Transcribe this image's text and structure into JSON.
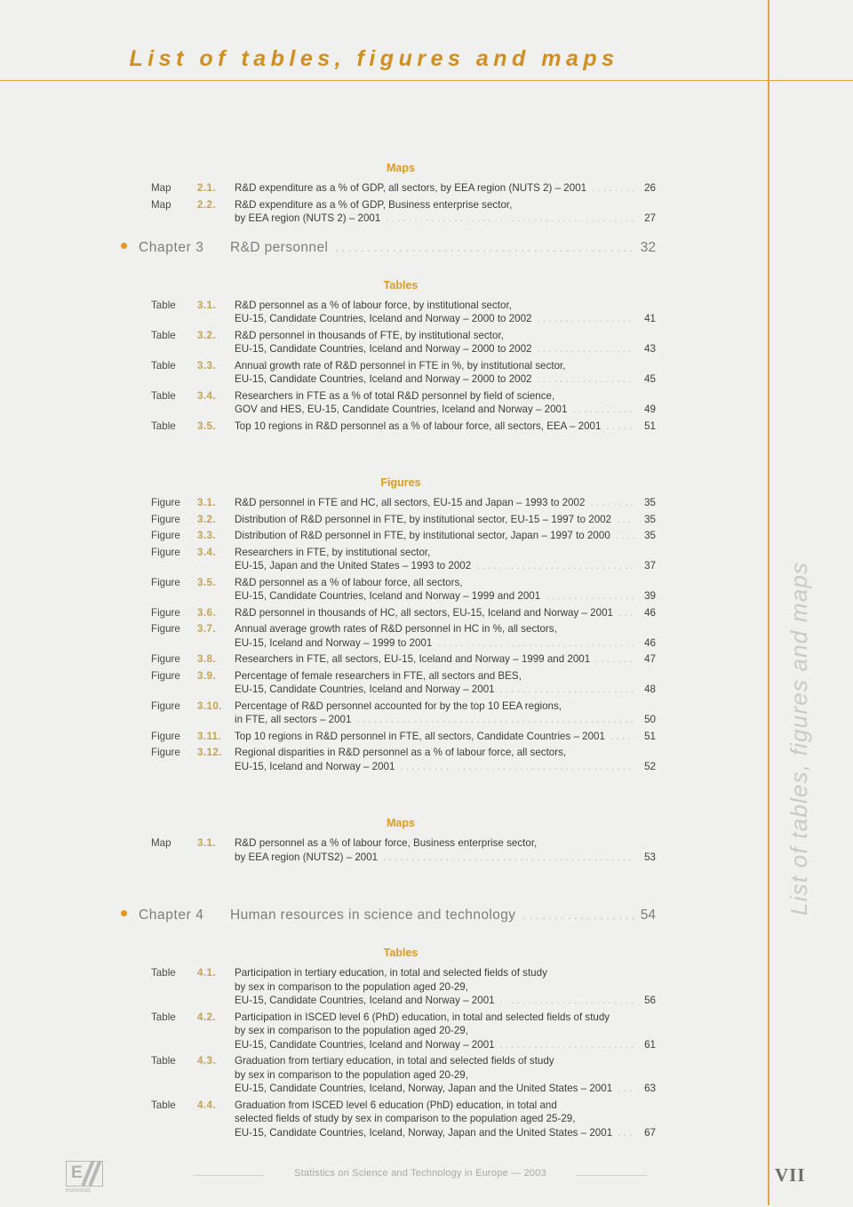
{
  "header": {
    "title": "List of tables, figures and maps"
  },
  "side_tab": {
    "label": "List of tables, figures and maps"
  },
  "labels": {
    "map": "Map",
    "table": "Table",
    "figure": "Figure"
  },
  "sections": {
    "maps_ch2": "Maps",
    "tables_ch3": "Tables",
    "figures_ch3": "Figures",
    "maps_ch3": "Maps",
    "tables_ch4": "Tables"
  },
  "chapter3": {
    "name": "Chapter 3",
    "title": "R&D personnel",
    "page": "32"
  },
  "chapter4": {
    "name": "Chapter 4",
    "title": "Human resources in science and technology",
    "page": "54"
  },
  "maps_ch2_items": [
    {
      "kind": "Map",
      "num": "2.1.",
      "lines": [
        "R&D expenditure as a % of GDP, all sectors, by EEA region (NUTS 2) – 2001"
      ],
      "page": "26"
    },
    {
      "kind": "Map",
      "num": "2.2.",
      "lines": [
        "R&D expenditure as a % of GDP, Business enterprise sector,",
        "by EEA region (NUTS 2) – 2001"
      ],
      "page": "27"
    }
  ],
  "tables_ch3_items": [
    {
      "kind": "Table",
      "num": "3.1.",
      "lines": [
        "R&D personnel as a % of labour force, by institutional sector,",
        "EU-15, Candidate Countries, Iceland and Norway – 2000 to 2002"
      ],
      "page": "41"
    },
    {
      "kind": "Table",
      "num": "3.2.",
      "lines": [
        "R&D personnel in thousands of FTE, by institutional sector,",
        "EU-15, Candidate Countries, Iceland and Norway – 2000 to 2002"
      ],
      "page": "43"
    },
    {
      "kind": "Table",
      "num": "3.3.",
      "lines": [
        "Annual growth rate of R&D personnel in FTE in %, by institutional sector,",
        "EU-15, Candidate Countries, Iceland and Norway – 2000 to 2002"
      ],
      "page": "45"
    },
    {
      "kind": "Table",
      "num": "3.4.",
      "lines": [
        "Researchers in FTE as a % of total R&D personnel by field of science,",
        "GOV and HES, EU-15, Candidate Countries, Iceland and Norway – 2001"
      ],
      "page": "49"
    },
    {
      "kind": "Table",
      "num": "3.5.",
      "lines": [
        "Top 10 regions in R&D personnel as a % of labour force, all sectors, EEA – 2001"
      ],
      "page": "51"
    }
  ],
  "figures_ch3_items": [
    {
      "kind": "Figure",
      "num": "3.1.",
      "lines": [
        "R&D personnel in FTE and HC, all sectors, EU-15 and Japan – 1993 to 2002"
      ],
      "page": "35"
    },
    {
      "kind": "Figure",
      "num": "3.2.",
      "lines": [
        "Distribution of R&D personnel in FTE, by institutional sector, EU-15 – 1997 to 2002"
      ],
      "page": "35"
    },
    {
      "kind": "Figure",
      "num": "3.3.",
      "lines": [
        "Distribution of R&D personnel in FTE, by institutional sector, Japan – 1997 to 2000"
      ],
      "page": "35"
    },
    {
      "kind": "Figure",
      "num": "3.4.",
      "lines": [
        "Researchers in FTE, by institutional sector,",
        "EU-15, Japan and the United States – 1993 to 2002"
      ],
      "page": "37"
    },
    {
      "kind": "Figure",
      "num": "3.5.",
      "lines": [
        "R&D personnel as a % of labour force, all sectors,",
        "EU-15, Candidate Countries, Iceland and Norway – 1999 and 2001"
      ],
      "page": "39"
    },
    {
      "kind": "Figure",
      "num": "3.6.",
      "lines": [
        "R&D personnel in thousands of HC, all sectors, EU-15, Iceland and Norway – 2001"
      ],
      "page": "46"
    },
    {
      "kind": "Figure",
      "num": "3.7.",
      "lines": [
        "Annual average growth rates of R&D personnel in HC in %, all sectors,",
        "EU-15, Iceland and Norway – 1999 to 2001"
      ],
      "page": "46"
    },
    {
      "kind": "Figure",
      "num": "3.8.",
      "lines": [
        "Researchers in FTE, all sectors, EU-15, Iceland and Norway – 1999 and 2001"
      ],
      "page": "47"
    },
    {
      "kind": "Figure",
      "num": "3.9.",
      "lines": [
        "Percentage of female researchers in FTE, all sectors and BES,",
        "EU-15, Candidate Countries, Iceland and Norway – 2001"
      ],
      "page": "48"
    },
    {
      "kind": "Figure",
      "num": "3.10.",
      "lines": [
        "Percentage of R&D personnel accounted for by the top 10 EEA regions,",
        "in FTE, all sectors – 2001"
      ],
      "page": "50"
    },
    {
      "kind": "Figure",
      "num": "3.11.",
      "lines": [
        "Top 10 regions in R&D personnel in FTE, all sectors, Candidate Countries – 2001"
      ],
      "page": "51"
    },
    {
      "kind": "Figure",
      "num": "3.12.",
      "lines": [
        "Regional disparities in R&D personnel as a % of labour force, all sectors,",
        "EU-15, Iceland and Norway – 2001"
      ],
      "page": "52"
    }
  ],
  "maps_ch3_items": [
    {
      "kind": "Map",
      "num": "3.1.",
      "lines": [
        "R&D personnel as a % of labour force, Business enterprise sector,",
        "by EEA region (NUTS2) – 2001"
      ],
      "page": "53"
    }
  ],
  "tables_ch4_items": [
    {
      "kind": "Table",
      "num": "4.1.",
      "lines": [
        "Participation in tertiary education, in total and selected fields of study",
        "by sex in comparison to the population aged 20-29,",
        "EU-15, Candidate Countries, Iceland and Norway – 2001"
      ],
      "page": "56"
    },
    {
      "kind": "Table",
      "num": "4.2.",
      "lines": [
        "Participation in ISCED level 6 (PhD) education, in total and selected fields of study",
        "by sex in comparison to the population aged 20-29,",
        "EU-15, Candidate Countries, Iceland and Norway – 2001"
      ],
      "page": "61"
    },
    {
      "kind": "Table",
      "num": "4.3.",
      "lines": [
        "Graduation from tertiary education, in total and selected fields of study",
        "by sex in comparison to the population aged 20-29,",
        "EU-15, Candidate Countries, Iceland, Norway, Japan and the United States – 2001"
      ],
      "page": "63"
    },
    {
      "kind": "Table",
      "num": "4.4.",
      "lines": [
        "Graduation from ISCED level 6 education (PhD) education, in total and",
        "selected fields of study by sex in comparison to the population aged 25-29,",
        "EU-15, Candidate Countries, Iceland, Norway, Japan and the United States – 2001"
      ],
      "page": "67"
    }
  ],
  "footer": {
    "logo_text": "eurostat",
    "logo_mark": "E",
    "center_text": "Statistics on Science and Technology in Europe — 2003",
    "page_number": "VII"
  },
  "colors": {
    "accent": "#dda93f",
    "title": "#d08f22",
    "heading": "#dd9b22",
    "number": "#c5a257",
    "body": "#3d3d3d",
    "chapter": "#7d7d7d",
    "background": "#f0f0ef"
  }
}
